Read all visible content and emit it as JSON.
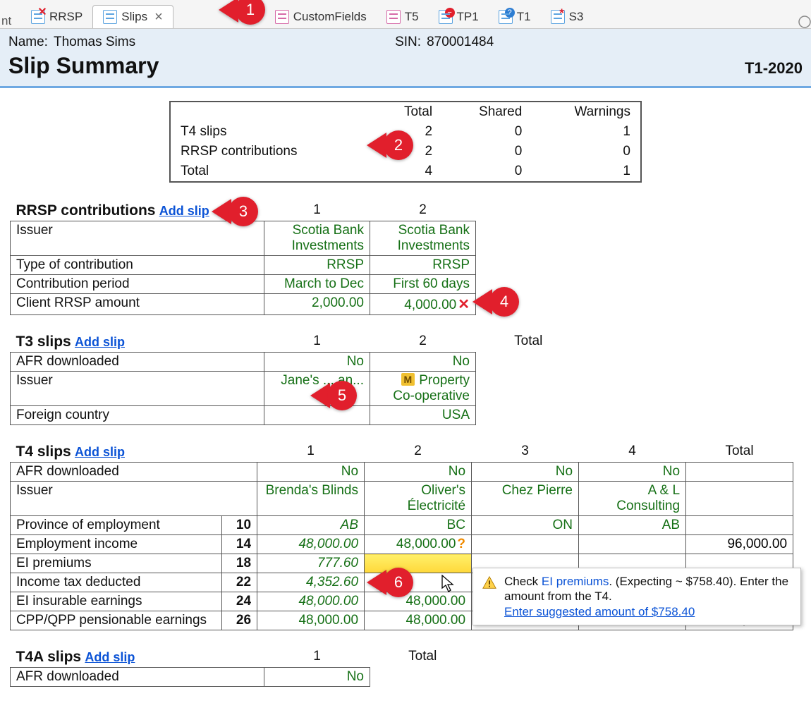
{
  "tabs": {
    "left_trunc": "nt",
    "items": [
      {
        "label": "RRSP",
        "icon": "form-x"
      },
      {
        "label": "Slips",
        "icon": "form",
        "active": true
      },
      {
        "label": "CustomFields",
        "icon": "form-pink"
      },
      {
        "label": "T5",
        "icon": "form-pink"
      },
      {
        "label": "TP1",
        "icon": "form-minus"
      },
      {
        "label": "T1",
        "icon": "form-q"
      },
      {
        "label": "S3",
        "icon": "form-star"
      }
    ]
  },
  "client": {
    "name_label": "Name:",
    "name": "Thomas Sims",
    "sin_label": "SIN:",
    "sin": "870001484"
  },
  "page": {
    "title": "Slip Summary",
    "doc": "T1-2020"
  },
  "summary": {
    "cols": [
      "",
      "Total",
      "Shared",
      "Warnings"
    ],
    "rows": [
      {
        "label": "T4 slips",
        "total": "2",
        "shared": "0",
        "warnings": "1"
      },
      {
        "label": "RRSP contributions",
        "total": "2",
        "shared": "0",
        "warnings": "0"
      },
      {
        "label": "Total",
        "total": "4",
        "shared": "0",
        "warnings": "1"
      }
    ]
  },
  "rrsp": {
    "title": "RRSP contributions",
    "add": "Add slip",
    "cols": [
      "1",
      "2"
    ],
    "rows": [
      {
        "label": "Issuer",
        "vals": [
          "Scotia Bank Investments",
          "Scotia Bank Investments"
        ]
      },
      {
        "label": "Type of contribution",
        "vals": [
          "RRSP",
          "RRSP"
        ]
      },
      {
        "label": "Contribution period",
        "vals": [
          "March to Dec",
          "First 60 days"
        ]
      },
      {
        "label": "Client RRSP amount",
        "vals": [
          "2,000.00",
          "4,000.00"
        ],
        "x_after": 1
      }
    ]
  },
  "t3": {
    "title": "T3 slips",
    "add": "Add slip",
    "cols": [
      "1",
      "2",
      "Total"
    ],
    "rows": [
      {
        "label": "AFR downloaded",
        "vals": [
          "No",
          "No",
          ""
        ]
      },
      {
        "label": "Issuer",
        "vals": [
          "Jane's ... an...",
          "Property Co-operative",
          ""
        ],
        "m_chip": 1
      },
      {
        "label": "Foreign country",
        "vals": [
          "",
          "USA",
          ""
        ]
      }
    ]
  },
  "t4": {
    "title": "T4 slips",
    "add": "Add slip",
    "cols": [
      "1",
      "2",
      "3",
      "4",
      "Total"
    ],
    "rows": [
      {
        "label": "AFR downloaded",
        "box": "",
        "vals": [
          "No",
          "No",
          "No",
          "No",
          ""
        ]
      },
      {
        "label": "Issuer",
        "box": "",
        "vals": [
          "Brenda's Blinds",
          "Oliver's Électricité",
          "Chez Pierre",
          "A & L Consulting",
          ""
        ]
      },
      {
        "label": "Province of employment",
        "box": "10",
        "vals": [
          "AB",
          "BC",
          "ON",
          "AB",
          ""
        ],
        "italic": true
      },
      {
        "label": "Employment income",
        "box": "14",
        "vals": [
          "48,000.00",
          "48,000.00",
          "",
          "",
          "96,000.00"
        ],
        "italic": true,
        "warn_after": 1
      },
      {
        "label": "EI premiums",
        "box": "18",
        "vals": [
          "777.60",
          "",
          "",
          "",
          ""
        ],
        "italic": true,
        "highlight": 1
      },
      {
        "label": "Income tax deducted",
        "box": "22",
        "vals": [
          "4,352.60",
          "",
          "",
          "",
          ""
        ],
        "italic": true
      },
      {
        "label": "EI insurable earnings",
        "box": "24",
        "vals": [
          "48,000.00",
          "48,000.00",
          "",
          "",
          ""
        ],
        "italic": true
      },
      {
        "label": "CPP/QPP pensionable earnings",
        "box": "26",
        "vals": [
          "48,000.00",
          "48,000.00",
          "",
          "",
          "58,700.00"
        ]
      }
    ]
  },
  "t4a": {
    "title": "T4A slips",
    "add": "Add slip",
    "cols": [
      "1",
      "Total"
    ],
    "rows": [
      {
        "label": "AFR downloaded",
        "vals": [
          "No",
          ""
        ]
      }
    ]
  },
  "tooltip": {
    "pre": "Check ",
    "kw": "EI premiums",
    "post": ". (Expecting ~ $758.40). Enter the amount from the T4.",
    "link": "Enter suggested amount of $758.40"
  },
  "callouts": {
    "c1": "1",
    "c2": "2",
    "c3": "3",
    "c4": "4",
    "c5": "5",
    "c6": "6"
  }
}
